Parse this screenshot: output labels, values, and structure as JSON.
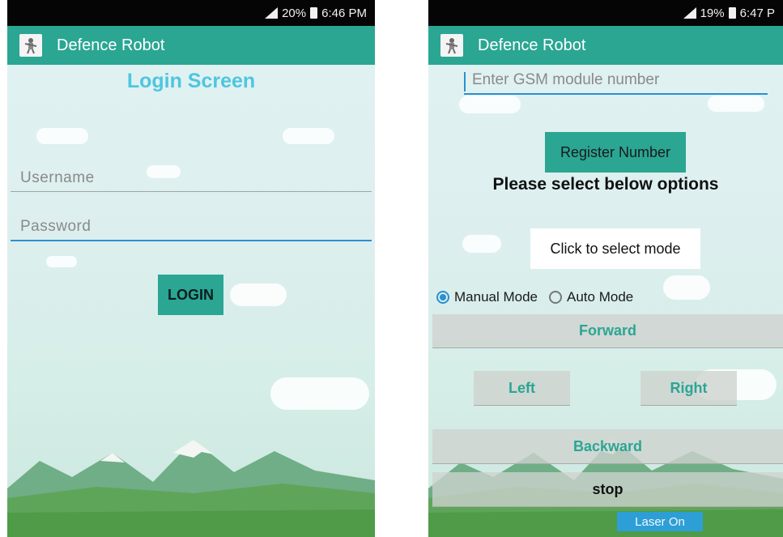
{
  "left_screen": {
    "status": {
      "battery": "20%",
      "time": "6:46 PM"
    },
    "app_bar": {
      "title": "Defence Robot",
      "icon": "robot-icon"
    },
    "title": "Login Screen",
    "username": {
      "placeholder": "Username"
    },
    "password": {
      "placeholder": "Password"
    },
    "login_button": "LOGIN"
  },
  "right_screen": {
    "status": {
      "battery": "19%",
      "time": "6:47 P"
    },
    "app_bar": {
      "title": "Defence Robot",
      "icon": "robot-icon"
    },
    "gsm_input": {
      "placeholder": "Enter GSM module number"
    },
    "register_button": "Register Number",
    "options_title": "Please select below options",
    "mode_button": "Click to select mode",
    "modes": {
      "manual": "Manual Mode",
      "auto": "Auto Mode",
      "selected": "manual"
    },
    "controls": {
      "forward": "Forward",
      "left": "Left",
      "right": "Right",
      "backward": "Backward",
      "stop": "stop",
      "laser": "Laser On"
    }
  },
  "colors": {
    "accent": "#2aa693",
    "title_blue": "#4ec6df",
    "focus_blue": "#2b8fd0",
    "laser_blue": "#2e9fd6"
  }
}
